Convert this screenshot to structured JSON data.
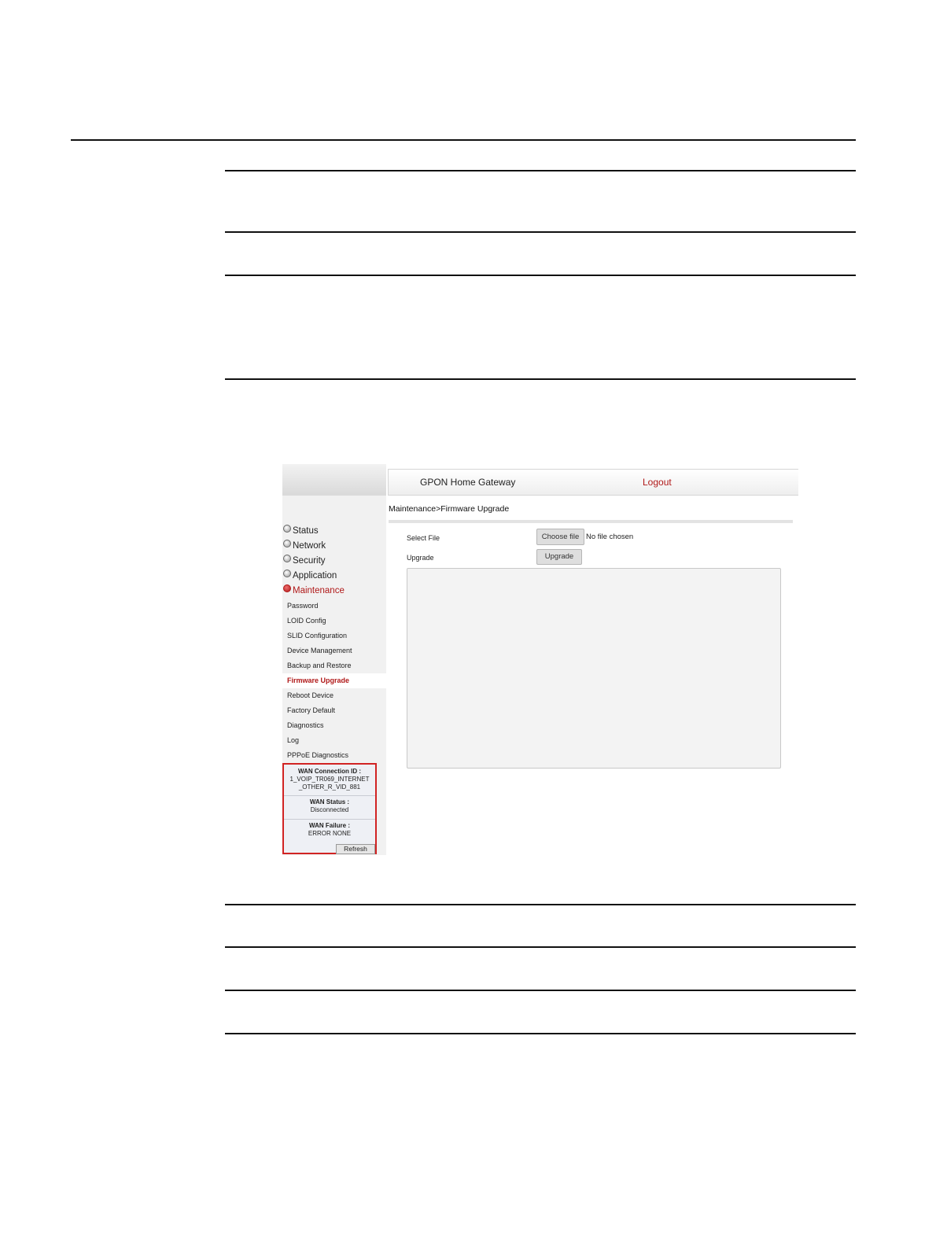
{
  "header": {
    "title": "GPON Home Gateway",
    "logout": "Logout"
  },
  "breadcrumb": "Maintenance>Firmware Upgrade",
  "nav": {
    "items": [
      "Status",
      "Network",
      "Security",
      "Application",
      "Maintenance"
    ],
    "active": "Maintenance",
    "sub_items": [
      "Password",
      "LOID Config",
      "SLID Configuration",
      "Device Management",
      "Backup and Restore",
      "Firmware Upgrade",
      "Reboot Device",
      "Factory Default",
      "Diagnostics",
      "Log",
      "PPPoE Diagnostics"
    ],
    "active_sub": "Firmware Upgrade"
  },
  "wan": {
    "conn_label": "WAN Connection ID :",
    "conn_value_1": "1_VOIP_TR069_INTERNET",
    "conn_value_2": "_OTHER_R_VID_881",
    "status_label": "WAN Status :",
    "status_value": "Disconnected",
    "failure_label": "WAN Failure :",
    "failure_value": "ERROR NONE",
    "refresh": "Refresh"
  },
  "form": {
    "select_file_label": "Select File",
    "choose_file": "Choose file",
    "no_file": "No file chosen",
    "upgrade_label": "Upgrade",
    "upgrade_button": "Upgrade"
  },
  "colors": {
    "accent": "#b01818",
    "highlight_border": "#d12323"
  }
}
